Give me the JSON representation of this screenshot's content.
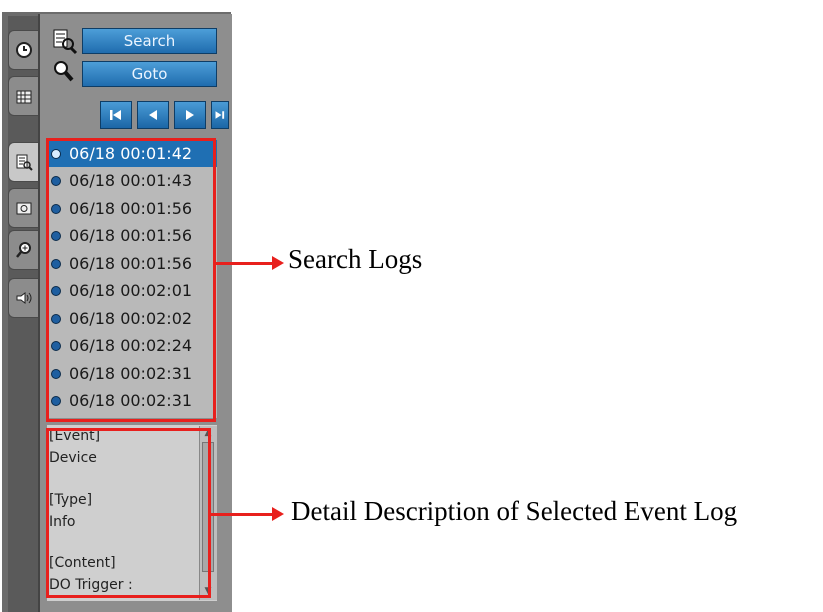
{
  "toolbar": {
    "search_label": "Search",
    "goto_label": "Goto"
  },
  "side_tabs": [
    {
      "icon": "clock-icon"
    },
    {
      "icon": "grid-icon"
    },
    {
      "icon": "search-log-icon"
    },
    {
      "icon": "camera-icon"
    },
    {
      "icon": "zoom-icon"
    },
    {
      "icon": "speaker-icon"
    }
  ],
  "nav": [
    "first-icon",
    "prev-icon",
    "next-icon",
    "last-icon"
  ],
  "logs": [
    {
      "time": "06/18 00:01:42"
    },
    {
      "time": "06/18 00:01:43"
    },
    {
      "time": "06/18 00:01:56"
    },
    {
      "time": "06/18 00:01:56"
    },
    {
      "time": "06/18 00:01:56"
    },
    {
      "time": "06/18 00:02:01"
    },
    {
      "time": "06/18 00:02:02"
    },
    {
      "time": "06/18 00:02:24"
    },
    {
      "time": "06/18 00:02:31"
    },
    {
      "time": "06/18 00:02:31"
    }
  ],
  "selected_index": 0,
  "detail": {
    "event_header": "[Event]",
    "event_value": "Device",
    "type_header": "[Type]",
    "type_value": "Info",
    "content_header": "[Content]",
    "content_value": "DO Trigger :"
  },
  "annotations": {
    "search_logs": "Search Logs",
    "detail_description": "Detail Description of Selected Event Log"
  },
  "colors": {
    "accent": "#e8201d",
    "selected_row": "#1f6fb3",
    "button_blue": "#2f7fc0"
  }
}
